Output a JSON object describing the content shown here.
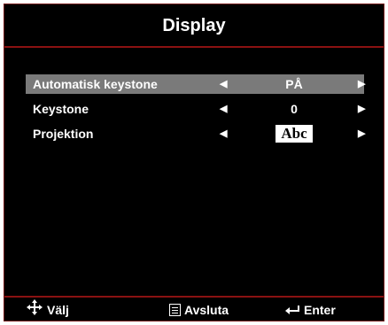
{
  "osd": {
    "title": "Display",
    "items": [
      {
        "label": "Automatisk keystone",
        "value": "PÅ",
        "selected": true
      },
      {
        "label": "Keystone",
        "value": "0",
        "selected": false
      },
      {
        "label": "Projektion",
        "value": "Abc",
        "selected": false
      }
    ],
    "footer": {
      "select_label": "Välj",
      "exit_label": "Avsluta",
      "enter_label": "Enter"
    },
    "icons": {
      "left": "arrow-left-icon",
      "right": "arrow-right-icon",
      "navigate": "dpad-arrows-icon",
      "menu": "menu-icon",
      "enter": "enter-return-icon"
    },
    "colors": {
      "background": "#000000",
      "accent_rule": "#8a1212",
      "selected_row": "#7a7a7a",
      "text": "#ffffff"
    }
  }
}
